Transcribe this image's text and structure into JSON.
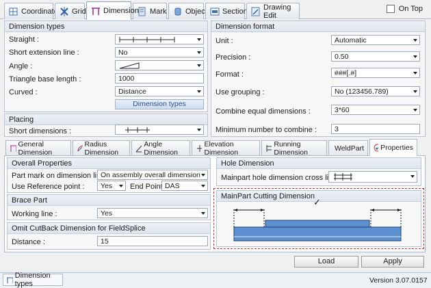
{
  "top_tabs": [
    {
      "label": "Coordinate"
    },
    {
      "label": "Grid"
    },
    {
      "label": "Dimension"
    },
    {
      "label": "Mark"
    },
    {
      "label": "Object"
    },
    {
      "label": "Section"
    },
    {
      "label": "Drawing Edit"
    }
  ],
  "on_top_label": "On Top",
  "dimension_types": {
    "title": "Dimension types",
    "straight_label": "Straight :",
    "short_extension_label": "Short extension line :",
    "short_extension_value": "No",
    "angle_label": "Angle :",
    "triangle_label": "Triangle base length :",
    "triangle_value": "1000",
    "curved_label": "Curved :",
    "curved_value": "Distance",
    "button_label": "Dimension types"
  },
  "placing": {
    "title": "Placing",
    "short_dimensions_label": "Short dimensions :"
  },
  "dimension_format": {
    "title": "Dimension format",
    "unit_label": "Unit :",
    "unit_value": "Automatic",
    "precision_label": "Precision :",
    "precision_value": "0.50",
    "format_label": "Format :",
    "format_value": "###[.#]",
    "grouping_label": "Use grouping :",
    "grouping_value": "No (123456.789)",
    "combine_label": "Combine equal dimensions :",
    "combine_value": "3*60",
    "min_label": "Minimum number to combine :",
    "min_value": "3"
  },
  "sub_tabs": [
    {
      "label": "General Dimension"
    },
    {
      "label": "Radius Dimension"
    },
    {
      "label": "Angle Dimension"
    },
    {
      "label": "Elevation Dimension"
    },
    {
      "label": "Running Dimension"
    },
    {
      "label": "WeldPart"
    },
    {
      "label": "Properties"
    }
  ],
  "overall_properties": {
    "title": "Overall Properties",
    "part_mark_label": "Part mark on dimension line :",
    "part_mark_value": "On assembly overall dimension",
    "use_ref_label": "Use Reference point :",
    "use_ref_value": "Yes",
    "end_point_label": "End Point",
    "end_point_value": "DAS"
  },
  "brace_part": {
    "title": "Brace Part",
    "working_line_label": "Working line :",
    "working_line_value": "Yes"
  },
  "omit_cutback": {
    "title": "Omit CutBack Dimension for FieldSplice",
    "distance_label": "Distance :",
    "distance_value": "15"
  },
  "hole_dimension": {
    "title": "Hole Dimension",
    "mainpart_hole_label": "Mainpart hole dimension cross line :"
  },
  "mainpart_cutting": {
    "title": "MainPart Cutting Dimension",
    "checkmark": "✓"
  },
  "buttons": {
    "load": "Load",
    "apply": "Apply"
  },
  "footer": {
    "dimension_types": "Dimension types",
    "version": "Version 3.07.0157"
  },
  "colors": {
    "accent": "#5b8fcf",
    "highlight_border": "#d9302c",
    "active_tab_border": "#8aa0bd"
  }
}
